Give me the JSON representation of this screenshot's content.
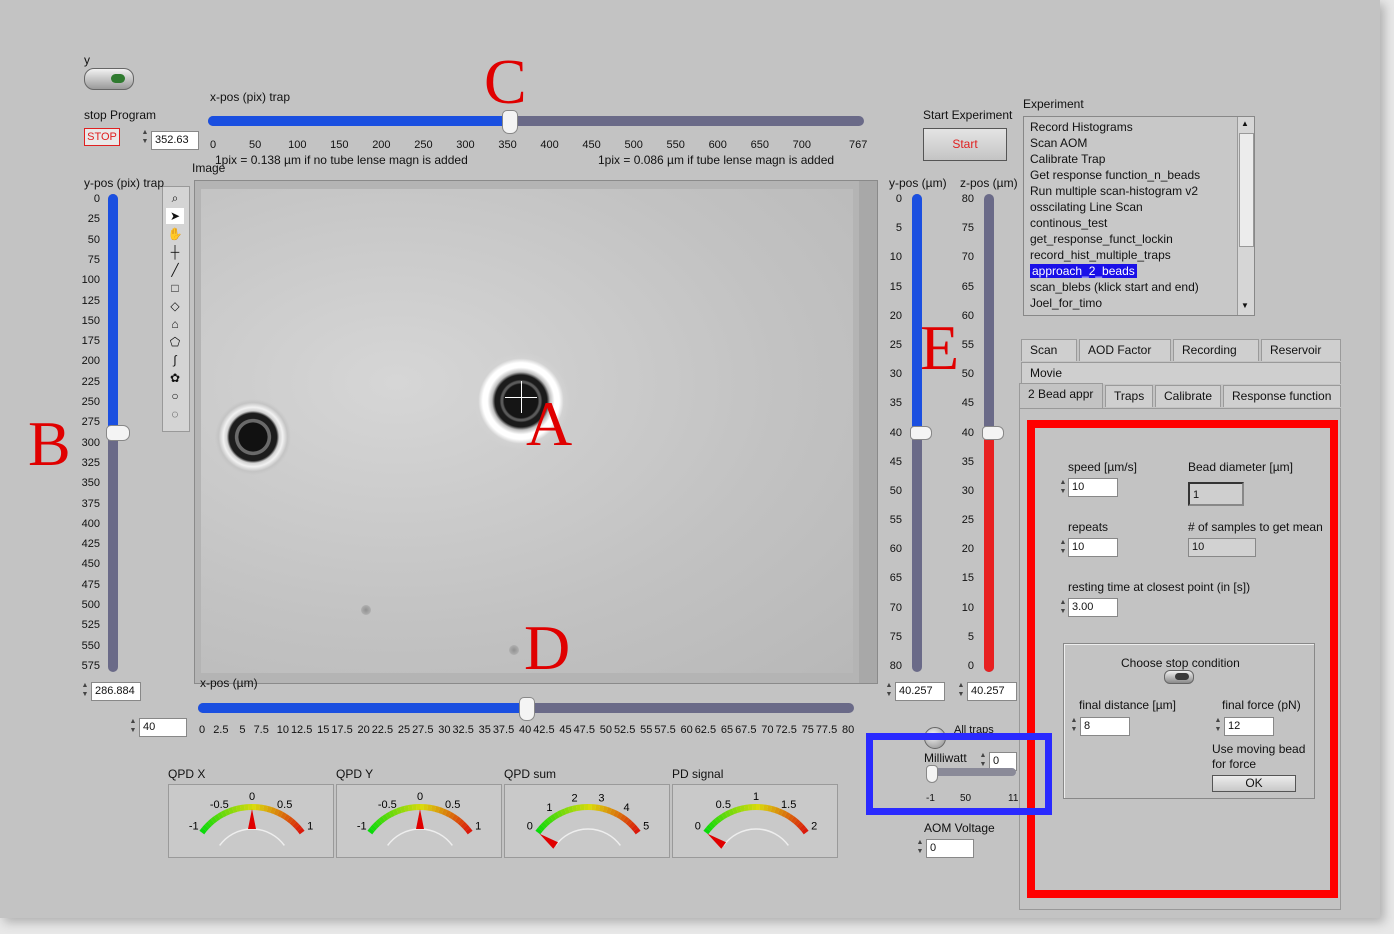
{
  "stop_toggle": {
    "label": "y"
  },
  "stop_program": {
    "label": "stop Program",
    "button": "STOP",
    "value": "352.63"
  },
  "xpos_trap": {
    "label": "x-pos (pix) trap",
    "ticks": [
      "0",
      "50",
      "100",
      "150",
      "200",
      "250",
      "300",
      "350",
      "400",
      "450",
      "500",
      "550",
      "600",
      "650",
      "700",
      "767"
    ],
    "fill": 0.46,
    "note1": "1pix = 0.138 µm if no tube lense magn  is added",
    "note2": "1pix = 0.086 µm if tube lense magn is added"
  },
  "image": {
    "label": "Image"
  },
  "ypos_trap": {
    "label": "y-pos (pix) trap",
    "ticks": [
      "0",
      "25",
      "50",
      "75",
      "100",
      "125",
      "150",
      "175",
      "200",
      "225",
      "250",
      "275",
      "300",
      "325",
      "350",
      "375",
      "400",
      "425",
      "450",
      "475",
      "500",
      "525",
      "550",
      "575"
    ],
    "value": "286.884",
    "fill": 0.5
  },
  "xpos_um": {
    "label": "x-pos (µm)",
    "value": "40",
    "ticks": [
      "0",
      "2.5",
      "5",
      "7.5",
      "10",
      "12.5",
      "15",
      "17.5",
      "20",
      "22.5",
      "25",
      "27.5",
      "30",
      "32.5",
      "35",
      "37.5",
      "40",
      "42.5",
      "45",
      "47.5",
      "50",
      "52.5",
      "55",
      "57.5",
      "60",
      "62.5",
      "65",
      "67.5",
      "70",
      "72.5",
      "75",
      "77.5",
      "80"
    ],
    "fill": 0.5
  },
  "ypos_um": {
    "label": "y-pos (µm)",
    "ticks": [
      "0",
      "5",
      "10",
      "15",
      "20",
      "25",
      "30",
      "35",
      "40",
      "45",
      "50",
      "55",
      "60",
      "65",
      "70",
      "75",
      "80"
    ],
    "value": "40.257",
    "fill": 0.5
  },
  "zpos_um": {
    "label": "z-pos (µm)",
    "ticks": [
      "80",
      "75",
      "70",
      "65",
      "60",
      "55",
      "50",
      "45",
      "40",
      "35",
      "30",
      "25",
      "20",
      "15",
      "10",
      "5",
      "0"
    ],
    "value": "40.257",
    "fill": 0.5
  },
  "annotations": {
    "A": "A",
    "B": "B",
    "C": "C",
    "D": "D",
    "E": "E"
  },
  "start_experiment": {
    "label": "Start Experiment",
    "button": "Start"
  },
  "experiment": {
    "label": "Experiment",
    "items": [
      "Record Histograms",
      "Scan AOM",
      "Calibrate Trap",
      "Get response function_n_beads",
      "Run multiple scan-histogram v2",
      "osscilating Line Scan",
      "continous_test",
      "get_response_funct_lockin",
      "record_hist_multiple_traps",
      "approach_2_beads",
      "scan_blebs (klick start and end)",
      "Joel_for_timo"
    ],
    "selected_index": 9
  },
  "tabs_row1": [
    "Scan",
    "AOD Factor",
    "Recording",
    "Reservoir"
  ],
  "tabs_row2": [
    "Movie"
  ],
  "tabs_row3": [
    "2 Bead appr",
    "Traps",
    "Calibrate",
    "Response function"
  ],
  "bead_panel": {
    "speed_label": "speed [µm/s]",
    "speed": "10",
    "bead_diam_label": "Bead diameter [µm]",
    "bead_diam": "1",
    "repeats_label": "repeats",
    "repeats": "10",
    "samples_label": "# of samples to get mean",
    "samples": "10",
    "resting_label": "resting time at closest point (in [s])",
    "resting": "3.00",
    "stop_label": "Choose stop condition",
    "final_dist_label": "final distance [µm]",
    "final_dist": "8",
    "final_force_label": "final force (pN)",
    "final_force": "12",
    "moving_bead_label": "Use moving bead\nfor force",
    "ok": "OK"
  },
  "all_traps": {
    "label": "All traps"
  },
  "milliwatt": {
    "label": "Milliwatt",
    "value": "0",
    "slider_ticks": [
      "-1",
      "50",
      "11"
    ]
  },
  "aom_voltage": {
    "label": "AOM Voltage",
    "value": "0"
  },
  "gauges": [
    {
      "label": "QPD X",
      "ticks": [
        "-1",
        "-0.5",
        "0",
        "0.5",
        "1"
      ],
      "value": 0
    },
    {
      "label": "QPD Y",
      "ticks": [
        "-1",
        "-0.5",
        "0",
        "0.5",
        "1"
      ],
      "value": 0
    },
    {
      "label": "QPD sum",
      "ticks": [
        "0",
        "1",
        "2",
        "3",
        "4",
        "5"
      ],
      "value": 0
    },
    {
      "label": "PD signal",
      "ticks": [
        "0",
        "0.5",
        "1",
        "1.5",
        "2"
      ],
      "value": 0
    }
  ],
  "colors": {
    "slider_blue": "#1a4fe0",
    "slider_red": "#e82020",
    "highlight_red": "#ff0000",
    "highlight_blue": "#2a2aff",
    "stop_red": "#e02020"
  }
}
